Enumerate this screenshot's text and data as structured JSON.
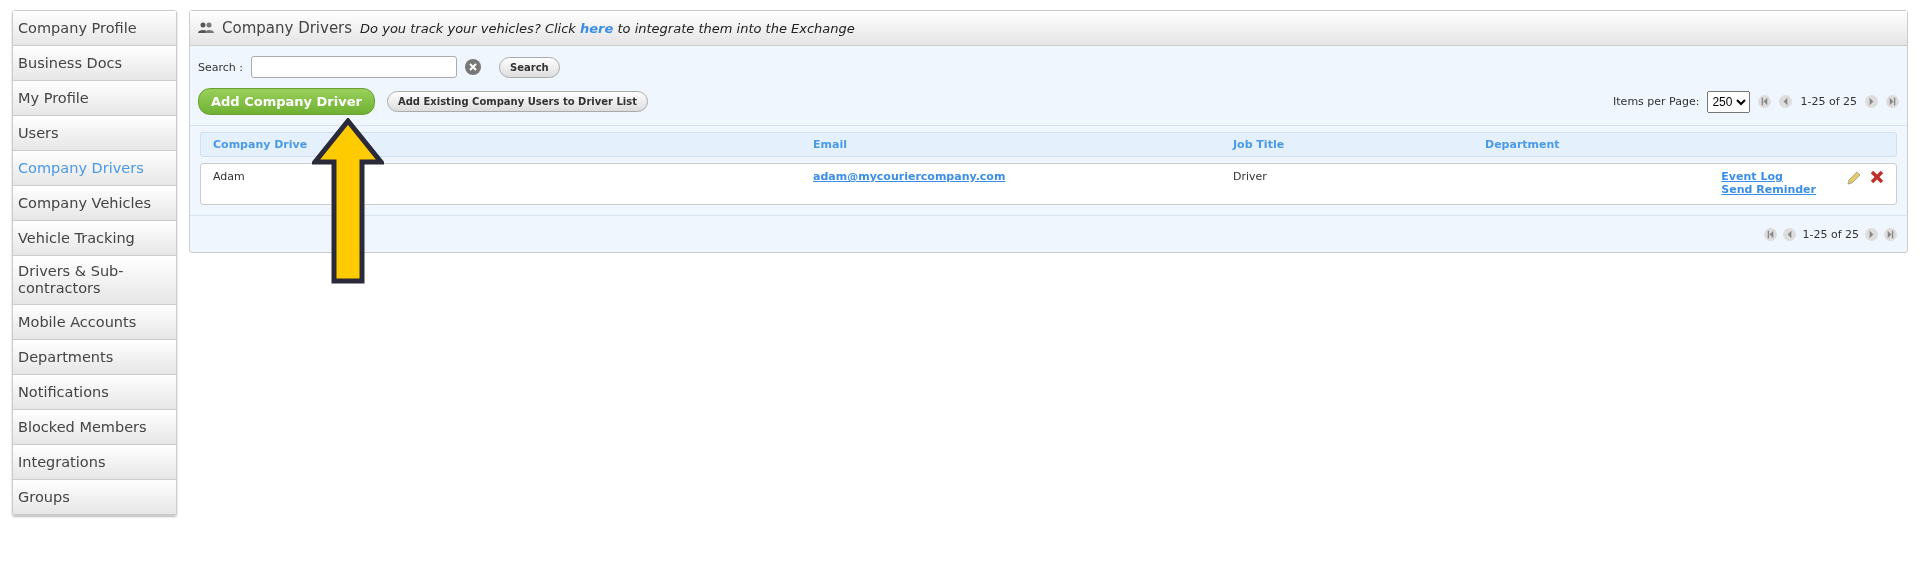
{
  "sidebar": {
    "items": [
      {
        "label": "Company Profile",
        "selected": false
      },
      {
        "label": "Business Docs",
        "selected": false
      },
      {
        "label": "My Profile",
        "selected": false
      },
      {
        "label": "Users",
        "selected": false
      },
      {
        "label": "Company Drivers",
        "selected": true
      },
      {
        "label": "Company Vehicles",
        "selected": false
      },
      {
        "label": "Vehicle Tracking",
        "selected": false
      },
      {
        "label": "Drivers & Sub-contractors",
        "selected": false
      },
      {
        "label": "Mobile Accounts",
        "selected": false
      },
      {
        "label": "Departments",
        "selected": false
      },
      {
        "label": "Notifications",
        "selected": false
      },
      {
        "label": "Blocked Members",
        "selected": false
      },
      {
        "label": "Integrations",
        "selected": false
      },
      {
        "label": "Groups",
        "selected": false
      }
    ]
  },
  "panel": {
    "title": "Company Drivers",
    "notice_before": "Do you track your vehicles? Click",
    "notice_link": "here",
    "notice_after": "to integrate them into the Exchange",
    "search": {
      "label": "Search :",
      "button": "Search"
    },
    "add_button": "Add Company Driver",
    "add_existing_button": "Add Existing Company Users to Driver List",
    "items_per_page_label": "Items per Page:",
    "items_per_page": "250",
    "page_range": "1-25 of 25",
    "page_range_bottom": "1-25 of 25",
    "table": {
      "columns": [
        "Company Drive",
        "Email",
        "Job Title",
        "Department"
      ],
      "rows": [
        {
          "name": "Adam",
          "email": "adam@mycouriercompany.com",
          "job_title": "Driver",
          "links": [
            "Event Log",
            "Send Reminder"
          ]
        }
      ]
    }
  }
}
